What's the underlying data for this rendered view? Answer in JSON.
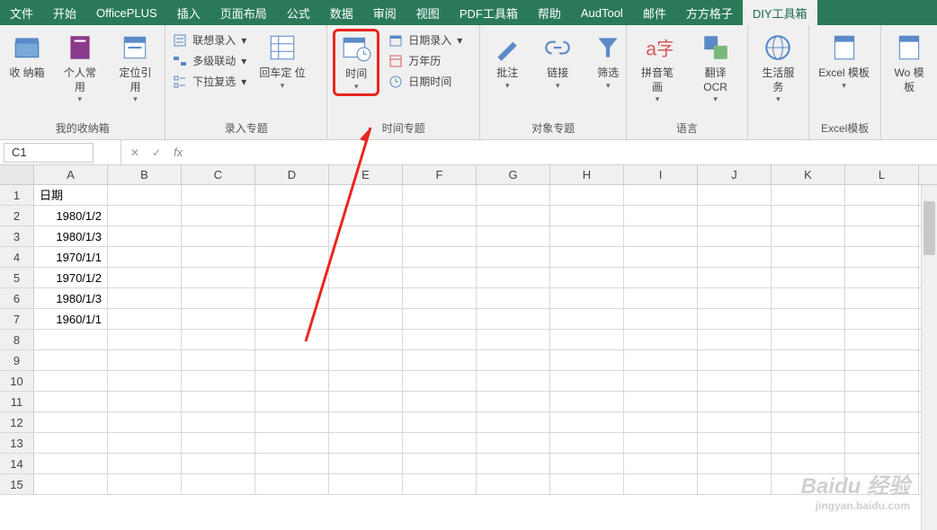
{
  "tabs": [
    {
      "label": "文件"
    },
    {
      "label": "开始"
    },
    {
      "label": "OfficePLUS"
    },
    {
      "label": "插入"
    },
    {
      "label": "页面布局"
    },
    {
      "label": "公式"
    },
    {
      "label": "数据"
    },
    {
      "label": "审阅"
    },
    {
      "label": "视图"
    },
    {
      "label": "PDF工具箱"
    },
    {
      "label": "帮助"
    },
    {
      "label": "AudTool"
    },
    {
      "label": "邮件"
    },
    {
      "label": "方方格子"
    },
    {
      "label": "DIY工具箱"
    }
  ],
  "active_tab": 14,
  "groups": {
    "g1": {
      "name": "我的收纳箱",
      "b1": "收\n纳箱",
      "b2": "个人常\n用",
      "b3": "定位引\n用"
    },
    "g2": {
      "name": "录入专题",
      "h1": "联想录入",
      "h2": "多级联动",
      "h3": "下拉复选",
      "b1": "回车定\n位"
    },
    "g3": {
      "name": "时间专题",
      "b1": "时间",
      "h1": "日期录入",
      "h2": "万年历",
      "h3": "日期时间"
    },
    "g4": {
      "name": "对象专题",
      "b1": "批注",
      "b2": "链接",
      "b3": "筛选"
    },
    "g5": {
      "name": "语言",
      "b1": "拼音笔\n画",
      "b2": "翻译\nOCR"
    },
    "g6": {
      "name": "",
      "b1": "生活服\n务"
    },
    "g7": {
      "name": "Excel模板",
      "b1": "Excel\n模板"
    },
    "g8": {
      "name": "",
      "b1": "Wo\n模板"
    }
  },
  "namebox": "C1",
  "cols": [
    "A",
    "B",
    "C",
    "D",
    "E",
    "F",
    "G",
    "H",
    "I",
    "J",
    "K",
    "L"
  ],
  "rows": [
    "1",
    "2",
    "3",
    "4",
    "5",
    "6",
    "7",
    "8",
    "9",
    "10",
    "11",
    "12",
    "13",
    "14",
    "15"
  ],
  "data": {
    "A1": "日期",
    "A2": "1980/1/2",
    "A3": "1980/1/3",
    "A4": "1970/1/1",
    "A5": "1970/1/2",
    "A6": "1980/1/3",
    "A7": "1960/1/1"
  },
  "watermark": {
    "main": "Baidu 经验",
    "sub": "jingyan.baidu.com"
  }
}
